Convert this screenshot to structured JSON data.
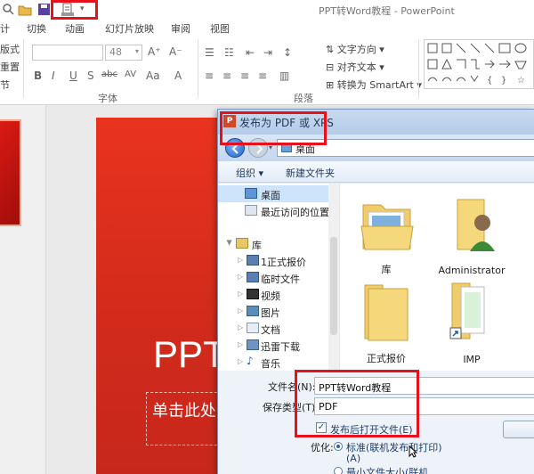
{
  "app": {
    "title": "PPT转Word教程 - PowerPoint"
  },
  "ribbon": {
    "tabs": [
      "计",
      "切换",
      "动画",
      "幻灯片放映",
      "审阅",
      "视图"
    ],
    "left_partial": [
      "版式",
      "重置",
      "节"
    ],
    "font_size": "48",
    "font_buttons": [
      "B",
      "I",
      "U",
      "S",
      "abc",
      "AV",
      "Aa",
      "A"
    ],
    "group_font": "字体",
    "group_paragraph": "段落",
    "text_direction": "文字方向",
    "align_text": "对齐文本",
    "convert_smartart": "转换为 SmartArt"
  },
  "slide": {
    "title": "PPT",
    "subtitle": "单击此处"
  },
  "dialog": {
    "title": "发布为 PDF 或 XPS",
    "address": "桌面",
    "organize": "组织 ▾",
    "new_folder": "新建文件夹",
    "nav": {
      "desktop": "桌面",
      "recent": "最近访问的位置",
      "library": "库",
      "folder1": "1正式报价",
      "folder2": "临时文件",
      "videos": "视频",
      "pictures": "图片",
      "documents": "文档",
      "thunder": "迅雷下载",
      "music": "音乐"
    },
    "files": [
      "库",
      "Administrator",
      "正式报价",
      "IMP"
    ],
    "filename_label": "文件名(N):",
    "filename": "PPT转Word教程",
    "filetype_label": "保存类型(T):",
    "filetype": "PDF",
    "open_after": "发布后打开文件(E)",
    "optimize_label": "优化:",
    "opt_standard": "标准(联机发布和打印)",
    "opt_standard_key": "(A)",
    "opt_min": "最小文件大小(联机"
  },
  "colors": {
    "highlight": "#e8101a",
    "slide_red": "#d22b1c",
    "dialog_bg": "#dfe9f5"
  }
}
